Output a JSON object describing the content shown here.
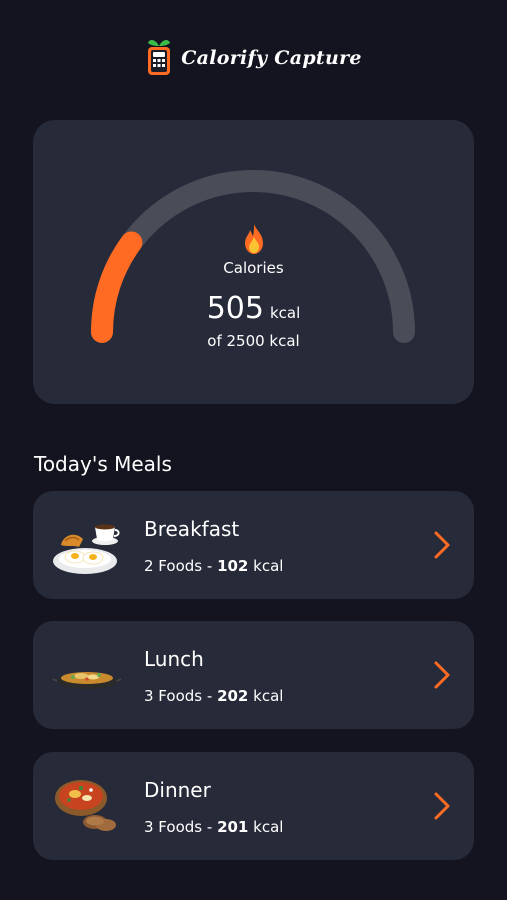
{
  "app": {
    "title": "Calorify Capture",
    "logo_icon": "calculator-leaf-logo"
  },
  "colors": {
    "background": "#13141f",
    "card": "#272a39",
    "accent": "#ff6b23",
    "gauge_track": "#4a4c58"
  },
  "calories": {
    "label": "Calories",
    "icon": "fire-icon",
    "value": "505",
    "unit": "kcal",
    "goal_text": "of 2500 kcal",
    "consumed": 505,
    "goal": 2500
  },
  "meals_section": {
    "title": "Today's Meals"
  },
  "meals": [
    {
      "name": "Breakfast",
      "foods_text": "2 Foods",
      "separator": " - ",
      "kcal_value": "102",
      "kcal_unit": " kcal",
      "image_icon": "breakfast-plate-image"
    },
    {
      "name": "Lunch",
      "foods_text": "3 Foods",
      "separator": " - ",
      "kcal_value": "202",
      "kcal_unit": " kcal",
      "image_icon": "lunch-bowl-image"
    },
    {
      "name": "Dinner",
      "foods_text": "3 Foods",
      "separator": " - ",
      "kcal_value": "201",
      "kcal_unit": " kcal",
      "image_icon": "dinner-stew-image"
    }
  ]
}
